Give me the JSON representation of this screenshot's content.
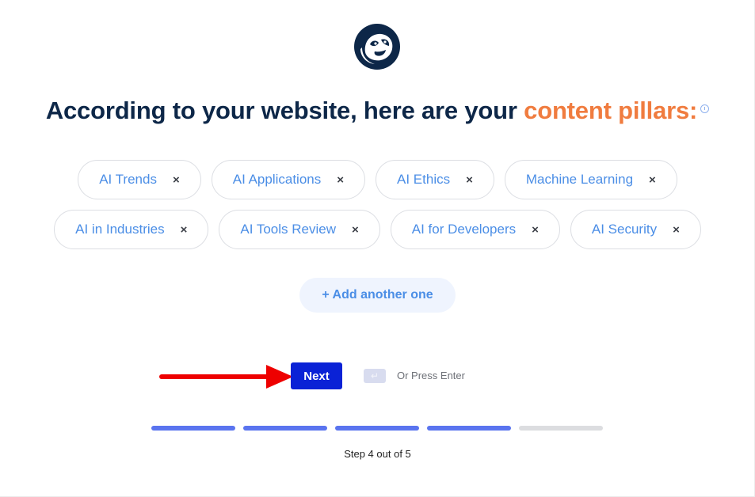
{
  "header": {
    "logo": "sloth-logo",
    "title_prefix": "According to your website, here are your ",
    "title_accent": "content pillars:",
    "info_icon": "info-icon",
    "colors": {
      "title": "#0d2748",
      "accent": "#f07c3f"
    }
  },
  "pillars": {
    "row1": [
      {
        "label": "AI Trends",
        "remove": "×"
      },
      {
        "label": "AI Applications",
        "remove": "×"
      },
      {
        "label": "AI Ethics",
        "remove": "×"
      },
      {
        "label": "Machine Learning",
        "remove": "×"
      }
    ],
    "row2": [
      {
        "label": "AI in Industries",
        "remove": "×"
      },
      {
        "label": "AI Tools Review",
        "remove": "×"
      },
      {
        "label": "AI for Developers",
        "remove": "×"
      },
      {
        "label": "AI Security",
        "remove": "×"
      }
    ]
  },
  "add_button": {
    "label": "+ Add another one"
  },
  "actions": {
    "next_label": "Next",
    "enter_key": "↵",
    "enter_hint": "Or Press Enter",
    "annotation": "red-arrow-pointing-to-next",
    "colors": {
      "next_bg": "#0a22d6",
      "arrow": "#ee0000"
    }
  },
  "progress": {
    "current_step": 4,
    "total_steps": 5,
    "label": "Step 4 out of 5",
    "colors": {
      "done": "#5a74ef",
      "pending": "#dcdde0"
    }
  }
}
